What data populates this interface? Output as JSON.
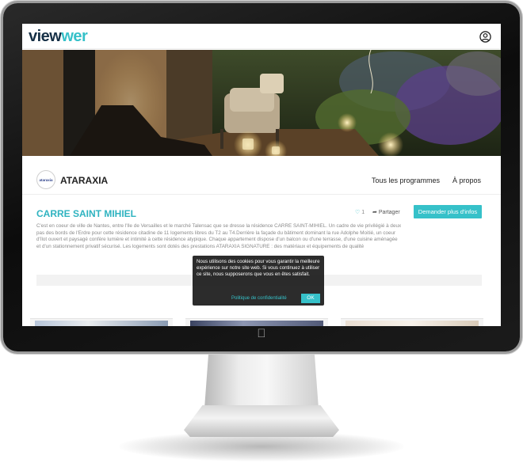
{
  "header": {
    "logo_part1": "view",
    "logo_part2": "wer",
    "user_icon": "user-circle-icon"
  },
  "banner": {
    "description": "terrace-garden-photo"
  },
  "brand": {
    "logo_text": "ataraxia",
    "name": "ATARAXIA"
  },
  "nav": {
    "programs": "Tous les programmes",
    "about": "À propos"
  },
  "program": {
    "title": "CARRE SAINT MIHIEL",
    "likes": "1",
    "share_label": "Partager",
    "cta_label": "Demander plus d'infos",
    "description": "C'est en coeur de ville de Nantes, entre l'Ile de Versailles et le marché Talensac que se dresse la résidence CARRE SAINT-MIHIEL. Un cadre de vie privilégié à deux pas des bords de l'Erdre pour cette résidence citadine de 11 logements libres du T2 au T4.Derrière la façade du bâtiment dominant la rue Adolphe Moitié, un coeur d'îlot ouvert et paysagé confère lumière et intimité à cette résidence atypique. Chaque appartement dispose d'un balcon ou d'une terrasse, d'une cuisine aménagée et d'un stationnement privatif sécurisé. Les logements sont dotés des prestations ATARAXIA SIGNATURE : des matériaux et équipements de qualité"
  },
  "cookie": {
    "text": "Nous utilisons des cookies pour vous garantir la meilleure expérience sur notre site web. Si vous continuez à utiliser ce site, nous supposerons que vous en êtes satisfait.",
    "policy_link": "Politique de confidentialité",
    "ok_label": "OK"
  },
  "colors": {
    "accent": "#36c1c9",
    "title": "#2fb3c0",
    "logo_dark": "#163046",
    "bezel": "#111111"
  }
}
